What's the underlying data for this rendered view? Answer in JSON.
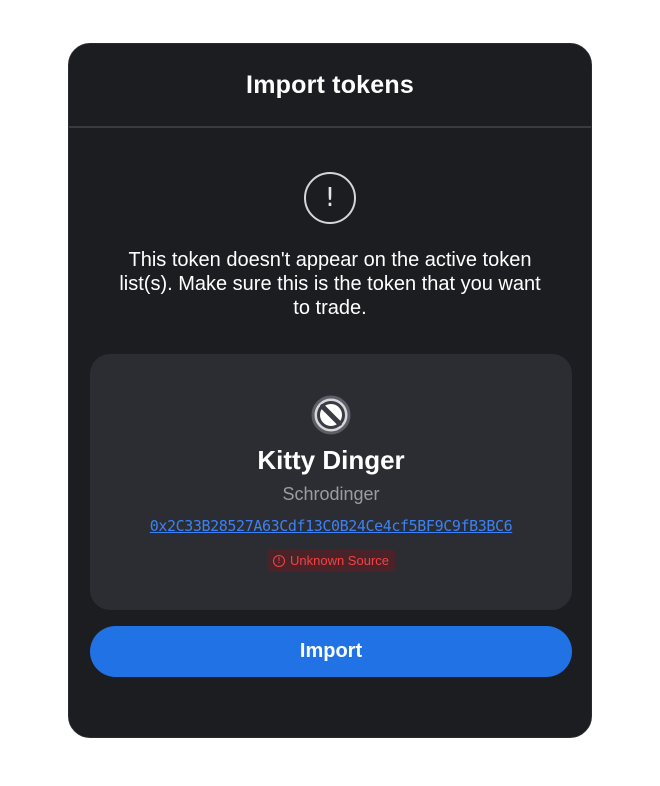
{
  "modal": {
    "title": "Import tokens",
    "warning_icon": "alert-circle-icon",
    "warning_text": "This token doesn't appear on the active token list(s). Make sure this is the token that you want to trade."
  },
  "token": {
    "logo_icon": "blocked-token-icon",
    "name": "Kitty Dinger",
    "symbol": "Schrodinger",
    "address": "0x2C33B28527A63Cdf13C0B24Ce4cf5BF9C9fB3BC6",
    "source_badge": {
      "icon": "alert-circle-icon",
      "label": "Unknown Source",
      "color": "#ef4444"
    }
  },
  "actions": {
    "import_label": "Import"
  },
  "colors": {
    "modal_bg": "#1c1d20",
    "card_bg": "#2b2d33",
    "accent": "#2172e5",
    "link": "#3b82f6"
  }
}
